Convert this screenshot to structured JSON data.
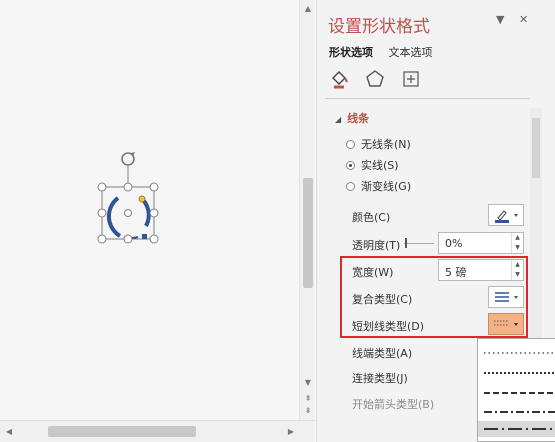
{
  "panel": {
    "title": "设置形状格式",
    "pin_icon": "chevron-down-icon",
    "close_label": "✕",
    "tabs": [
      {
        "label": "形状选项",
        "active": true
      },
      {
        "label": "文本选项",
        "active": false
      }
    ],
    "icons": [
      "fill-line-icon",
      "effects-pentagon-icon",
      "size-layout-icon"
    ],
    "section_label": "线条",
    "line_options": [
      {
        "label": "无线条(N)",
        "selected": false
      },
      {
        "label": "实线(S)",
        "selected": true
      },
      {
        "label": "渐变线(G)",
        "selected": false
      }
    ],
    "color_label": "颜色(C)",
    "transparency_label": "透明度(T)",
    "transparency_value": "0%",
    "width_label": "宽度(W)",
    "width_value": "5 磅",
    "compound_label": "复合类型(C)",
    "dash_label": "短划线类型(D)",
    "cap_label": "线端类型(A)",
    "join_label": "连接类型(J)",
    "arrow_begin_label": "开始箭头类型(B)"
  },
  "colors": {
    "title": "#c0504d",
    "accent_line": "#2f5597",
    "highlight_red": "#e1262b",
    "dash_button_fill": "#f4b183"
  }
}
